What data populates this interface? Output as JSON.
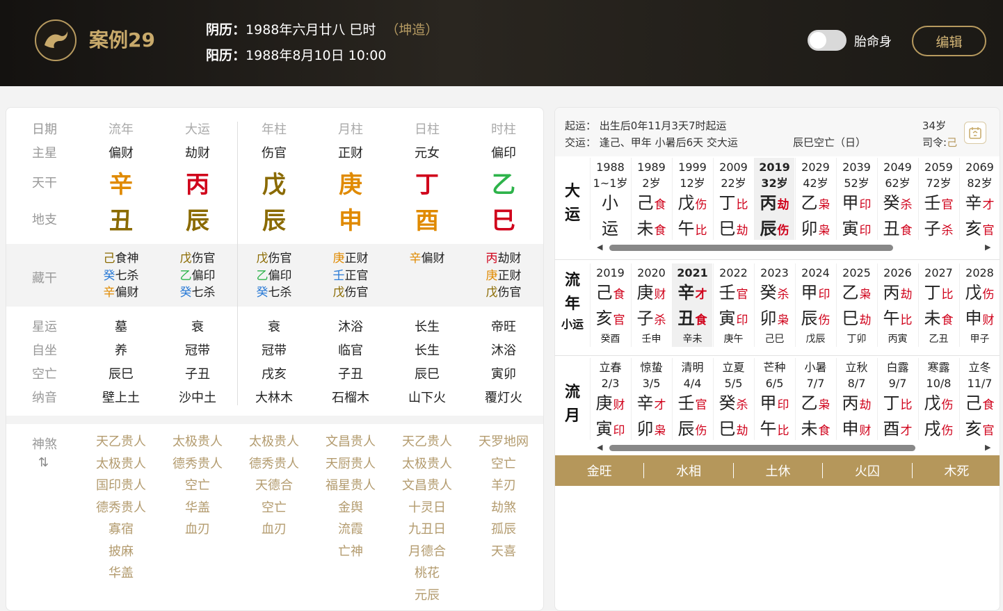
{
  "header": {
    "logo_icon": "dragon-icon",
    "title": "案例29",
    "lunar_label": "阴历：",
    "lunar_value": "1988年六月廿八 巳时",
    "gender": "（坤造）",
    "solar_label": "阳历：",
    "solar_value": "1988年8月10日 10:00",
    "toggle_label": "胎命身",
    "edit_label": "编辑"
  },
  "colors": {
    "accent": "#b5975b",
    "red": "#d0021b",
    "wood": "#2db34a",
    "earth": "#8a6a00",
    "metal": "#e08a00",
    "water": "#2b7bd6"
  },
  "left": {
    "row_labels": {
      "date": "日期",
      "zhuxing": "主星",
      "tiangan": "天干",
      "dizhi": "地支",
      "canggan": "藏干",
      "xingyun": "星运",
      "zizuo": "自坐",
      "kongwang": "空亡",
      "nayin": "纳音",
      "shensha": "神煞"
    },
    "shensha_toggle": "⇅",
    "columns": [
      {
        "head": "流年",
        "zhuxing": "偏财",
        "tg": "辛",
        "tg_el": "metal",
        "dz": "丑",
        "dz_el": "earth",
        "canggan": [
          {
            "g": "己",
            "el": "earth",
            "s": "食神"
          },
          {
            "g": "癸",
            "el": "water",
            "s": "七杀"
          },
          {
            "g": "辛",
            "el": "metal",
            "s": "偏财"
          }
        ],
        "xingyun": "墓",
        "zizuo": "养",
        "kongwang": "辰巳",
        "nayin": "壁上土",
        "shensha": [
          "天乙贵人",
          "太极贵人",
          "国印贵人",
          "德秀贵人",
          "寡宿",
          "披麻",
          "华盖"
        ]
      },
      {
        "head": "大运",
        "zhuxing": "劫财",
        "tg": "丙",
        "tg_el": "fire",
        "dz": "辰",
        "dz_el": "earth",
        "canggan": [
          {
            "g": "戊",
            "el": "earth",
            "s": "伤官"
          },
          {
            "g": "乙",
            "el": "wood",
            "s": "偏印"
          },
          {
            "g": "癸",
            "el": "water",
            "s": "七杀"
          }
        ],
        "xingyun": "衰",
        "zizuo": "冠带",
        "kongwang": "子丑",
        "nayin": "沙中土",
        "shensha": [
          "太极贵人",
          "德秀贵人",
          "空亡",
          "华盖",
          "血刃"
        ]
      },
      {
        "head": "年柱",
        "zhuxing": "伤官",
        "tg": "戊",
        "tg_el": "earth",
        "dz": "辰",
        "dz_el": "earth",
        "canggan": [
          {
            "g": "戊",
            "el": "earth",
            "s": "伤官"
          },
          {
            "g": "乙",
            "el": "wood",
            "s": "偏印"
          },
          {
            "g": "癸",
            "el": "water",
            "s": "七杀"
          }
        ],
        "xingyun": "衰",
        "zizuo": "冠带",
        "kongwang": "戌亥",
        "nayin": "大林木",
        "shensha": [
          "太极贵人",
          "德秀贵人",
          "天德合",
          "空亡",
          "血刃"
        ]
      },
      {
        "head": "月柱",
        "zhuxing": "正财",
        "tg": "庚",
        "tg_el": "metal",
        "dz": "申",
        "dz_el": "metal",
        "canggan": [
          {
            "g": "庚",
            "el": "metal",
            "s": "正财"
          },
          {
            "g": "壬",
            "el": "water",
            "s": "正官"
          },
          {
            "g": "戊",
            "el": "earth",
            "s": "伤官"
          }
        ],
        "xingyun": "沐浴",
        "zizuo": "临官",
        "kongwang": "子丑",
        "nayin": "石榴木",
        "shensha": [
          "文昌贵人",
          "天厨贵人",
          "福星贵人",
          "金舆",
          "流霞",
          "亡神"
        ]
      },
      {
        "head": "日柱",
        "zhuxing": "元女",
        "tg": "丁",
        "tg_el": "fire",
        "dz": "酉",
        "dz_el": "metal",
        "canggan": [
          {
            "g": "辛",
            "el": "metal",
            "s": "偏财"
          }
        ],
        "xingyun": "长生",
        "zizuo": "长生",
        "kongwang": "辰巳",
        "nayin": "山下火",
        "shensha": [
          "天乙贵人",
          "太极贵人",
          "文昌贵人",
          "十灵日",
          "九丑日",
          "月德合",
          "桃花",
          "元辰"
        ]
      },
      {
        "head": "时柱",
        "zhuxing": "偏印",
        "tg": "乙",
        "tg_el": "wood",
        "dz": "巳",
        "dz_el": "fire",
        "canggan": [
          {
            "g": "丙",
            "el": "fire",
            "s": "劫财"
          },
          {
            "g": "庚",
            "el": "metal",
            "s": "正财"
          },
          {
            "g": "戊",
            "el": "earth",
            "s": "伤官"
          }
        ],
        "xingyun": "帝旺",
        "zizuo": "沐浴",
        "kongwang": "寅卯",
        "nayin": "覆灯火",
        "shensha": [
          "天罗地网",
          "空亡",
          "羊刃",
          "劫煞",
          "孤辰",
          "天喜"
        ]
      }
    ]
  },
  "right": {
    "qiyun_label": "起运：",
    "qiyun_value": "出生后0年11月3天7时起运",
    "age": "34岁",
    "jiaoyun_label": "交运：",
    "jiaoyun_value": "逢己、甲年 小暑后6天 交大运",
    "kongwang": "辰巳空亡（日）",
    "siling_label": "司令:",
    "siling_value": "己",
    "age_icon": "calendar-today-icon",
    "dayun_label": [
      "大",
      "运"
    ],
    "dayun": [
      {
        "y": "1988",
        "a": "1~1岁",
        "g": "小",
        "gt": "",
        "z": "运",
        "zt": ""
      },
      {
        "y": "1989",
        "a": "2岁",
        "g": "己",
        "gt": "食",
        "z": "未",
        "zt": "食"
      },
      {
        "y": "1999",
        "a": "12岁",
        "g": "戊",
        "gt": "伤",
        "z": "午",
        "zt": "比"
      },
      {
        "y": "2009",
        "a": "22岁",
        "g": "丁",
        "gt": "比",
        "z": "巳",
        "zt": "劫"
      },
      {
        "y": "2019",
        "a": "32岁",
        "g": "丙",
        "gt": "劫",
        "z": "辰",
        "zt": "伤",
        "sel": true
      },
      {
        "y": "2029",
        "a": "42岁",
        "g": "乙",
        "gt": "枭",
        "z": "卯",
        "zt": "枭"
      },
      {
        "y": "2039",
        "a": "52岁",
        "g": "甲",
        "gt": "印",
        "z": "寅",
        "zt": "印"
      },
      {
        "y": "2049",
        "a": "62岁",
        "g": "癸",
        "gt": "杀",
        "z": "丑",
        "zt": "食"
      },
      {
        "y": "2059",
        "a": "72岁",
        "g": "壬",
        "gt": "官",
        "z": "子",
        "zt": "杀"
      },
      {
        "y": "2069",
        "a": "82岁",
        "g": "辛",
        "gt": "才",
        "z": "亥",
        "zt": "官"
      }
    ],
    "liunian_label": [
      "流",
      "年"
    ],
    "xiaoyun_label": "小运",
    "liunian": [
      {
        "y": "2019",
        "g": "己",
        "gt": "食",
        "z": "亥",
        "zt": "官",
        "x": "癸酉"
      },
      {
        "y": "2020",
        "g": "庚",
        "gt": "财",
        "z": "子",
        "zt": "杀",
        "x": "壬申"
      },
      {
        "y": "2021",
        "g": "辛",
        "gt": "才",
        "z": "丑",
        "zt": "食",
        "x": "辛未",
        "sel": true
      },
      {
        "y": "2022",
        "g": "壬",
        "gt": "官",
        "z": "寅",
        "zt": "印",
        "x": "庚午"
      },
      {
        "y": "2023",
        "g": "癸",
        "gt": "杀",
        "z": "卯",
        "zt": "枭",
        "x": "己巳"
      },
      {
        "y": "2024",
        "g": "甲",
        "gt": "印",
        "z": "辰",
        "zt": "伤",
        "x": "戊辰"
      },
      {
        "y": "2025",
        "g": "乙",
        "gt": "枭",
        "z": "巳",
        "zt": "劫",
        "x": "丁卯"
      },
      {
        "y": "2026",
        "g": "丙",
        "gt": "劫",
        "z": "午",
        "zt": "比",
        "x": "丙寅"
      },
      {
        "y": "2027",
        "g": "丁",
        "gt": "比",
        "z": "未",
        "zt": "食",
        "x": "乙丑"
      },
      {
        "y": "2028",
        "g": "戊",
        "gt": "伤",
        "z": "申",
        "zt": "财",
        "x": "甲子"
      }
    ],
    "liuyue_label": [
      "流",
      "月"
    ],
    "liuyue": [
      {
        "t": "立春",
        "d": "2/3",
        "g": "庚",
        "gt": "财",
        "z": "寅",
        "zt": "印"
      },
      {
        "t": "惊蛰",
        "d": "3/5",
        "g": "辛",
        "gt": "才",
        "z": "卯",
        "zt": "枭"
      },
      {
        "t": "清明",
        "d": "4/4",
        "g": "壬",
        "gt": "官",
        "z": "辰",
        "zt": "伤"
      },
      {
        "t": "立夏",
        "d": "5/5",
        "g": "癸",
        "gt": "杀",
        "z": "巳",
        "zt": "劫"
      },
      {
        "t": "芒种",
        "d": "6/5",
        "g": "甲",
        "gt": "印",
        "z": "午",
        "zt": "比"
      },
      {
        "t": "小暑",
        "d": "7/7",
        "g": "乙",
        "gt": "枭",
        "z": "未",
        "zt": "食"
      },
      {
        "t": "立秋",
        "d": "8/7",
        "g": "丙",
        "gt": "劫",
        "z": "申",
        "zt": "财"
      },
      {
        "t": "白露",
        "d": "9/7",
        "g": "丁",
        "gt": "比",
        "z": "酉",
        "zt": "才"
      },
      {
        "t": "寒露",
        "d": "10/8",
        "g": "戊",
        "gt": "伤",
        "z": "戌",
        "zt": "伤"
      },
      {
        "t": "立冬",
        "d": "11/7",
        "g": "己",
        "gt": "食",
        "z": "亥",
        "zt": "官"
      }
    ],
    "wuxing": [
      "金旺",
      "水相",
      "土休",
      "火囚",
      "木死"
    ]
  }
}
